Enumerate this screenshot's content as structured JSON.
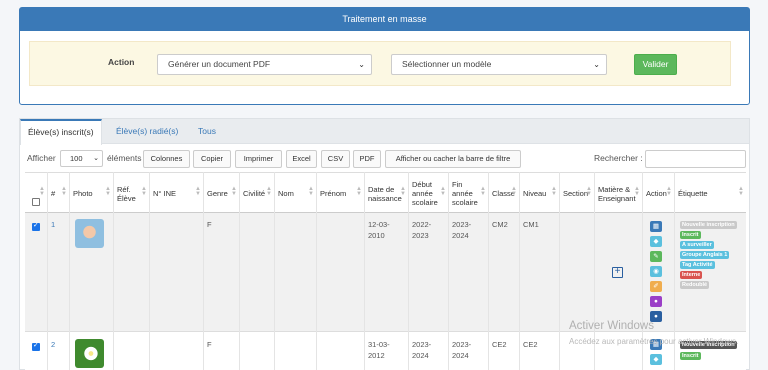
{
  "mass_panel": {
    "title": "Traitement en masse",
    "action_label": "Action",
    "action_select": "Générer un document PDF",
    "model_select": "Sélectionner un modèle",
    "submit": "Valider"
  },
  "tabs": [
    {
      "label": "Élève(s) inscrit(s)",
      "active": true
    },
    {
      "label": "Élève(s) radié(s)",
      "active": false
    },
    {
      "label": "Tous",
      "active": false
    }
  ],
  "toolbar": {
    "show_label": "Afficher",
    "page_length": "100",
    "elements_label": "éléments",
    "buttons": [
      "Colonnes",
      "Copier",
      "Imprimer",
      "Excel",
      "CSV",
      "PDF",
      "Afficher ou cacher la barre de filtre"
    ],
    "search_label": "Rechercher :"
  },
  "columns": [
    "#",
    "Photo",
    "Réf. Élève",
    "N° INE",
    "Genre",
    "Civilité",
    "Nom",
    "Prénom",
    "Date de naissance",
    "Début année scolaire",
    "Fin année scolaire",
    "Classe",
    "Niveau",
    "Section",
    "Matière & Enseignant",
    "Action",
    "Étiquette"
  ],
  "rows": [
    {
      "num": "1",
      "photo": "child-photo",
      "ref": "",
      "ine": "",
      "genre": "F",
      "civilite": "",
      "nom": "",
      "prenom": "",
      "naissance": "12-03-2010",
      "debut": "2022-2023",
      "fin": "2023-2024",
      "classe": "CM2",
      "niveau": "CM1",
      "section": "",
      "checked": true,
      "tags": [
        {
          "text": "Nouvelle inscription",
          "color": "#c9c9c9"
        },
        {
          "text": "Inscrit",
          "color": "#5cb85c"
        },
        {
          "text": "A surveiller",
          "color": "#5bc0de"
        },
        {
          "text": "Groupe Anglais 1",
          "color": "#5bc0de"
        },
        {
          "text": "Tag Activité",
          "color": "#5bc0de"
        },
        {
          "text": "Interne",
          "color": "#d9534f"
        },
        {
          "text": "Redoublé",
          "color": "#c9c9c9"
        }
      ]
    },
    {
      "num": "2",
      "photo": "flower-photo",
      "ref": "",
      "ine": "",
      "genre": "F",
      "civilite": "",
      "nom": "",
      "prenom": "",
      "naissance": "31-03-2012",
      "debut": "2023-2024",
      "fin": "2023-2024",
      "classe": "CE2",
      "niveau": "CE2",
      "section": "",
      "checked": true,
      "tags": [
        {
          "text": "Nouvelle inscription",
          "color": "#555555"
        },
        {
          "text": "Inscrit",
          "color": "#5cb85c"
        }
      ]
    }
  ],
  "action_icon_colors": [
    "#3a79b7",
    "#5bc0de",
    "#5cb85c",
    "#5bc0de",
    "#f0ad4e",
    "#9b3fc7",
    "#2a5fa0"
  ],
  "watermark": {
    "line1": "Activer Windows",
    "line2": "Accédez aux paramètres pour activer Windows."
  }
}
